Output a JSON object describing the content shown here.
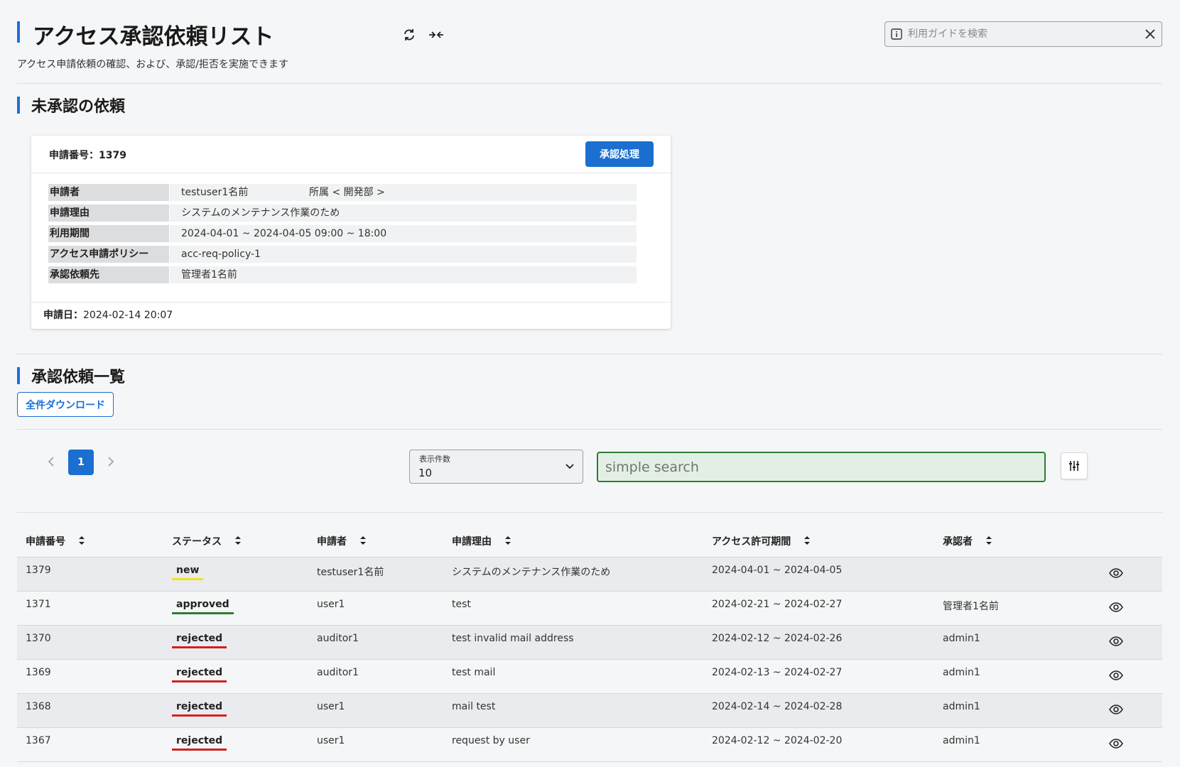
{
  "header": {
    "title": "アクセス承認依頼リスト",
    "subtitle": "アクセス申請依頼の確認、および、承認/拒否を実施できます",
    "guide_search_placeholder": "利用ガイドを検索"
  },
  "pending": {
    "section_title": "未承認の依頼",
    "card": {
      "id_label": "申請番号：1379",
      "approve_button": "承認処理",
      "details": [
        {
          "key": "申請者",
          "value": "testuser1名前",
          "extra": "所属 < 開発部 >"
        },
        {
          "key": "申請理由",
          "value": "システムのメンテナンス作業のため"
        },
        {
          "key": "利用期間",
          "value": "2024-04-01 ~ 2024-04-05 09:00 ~ 18:00"
        },
        {
          "key": "アクセス申請ポリシー",
          "value": "acc-req-policy-1"
        },
        {
          "key": "承認依頼先",
          "value": "管理者1名前"
        }
      ],
      "date_label": "申請日",
      "date_value": "2024-02-14 20:07"
    }
  },
  "list": {
    "section_title": "承認依頼一覧",
    "download_button": "全件ダウンロード",
    "pagination": {
      "current_page": "1"
    },
    "per_page": {
      "label": "表示件数",
      "value": "10"
    },
    "search_placeholder": "simple search",
    "columns": [
      "申請番号",
      "ステータス",
      "申請者",
      "申請理由",
      "アクセス許可期間",
      "承認者"
    ],
    "rows": [
      {
        "id": "1379",
        "status": "new",
        "applicant": "testuser1名前",
        "reason": "システムのメンテナンス作業のため",
        "period": "2024-04-01 ~ 2024-04-05",
        "approver": ""
      },
      {
        "id": "1371",
        "status": "approved",
        "applicant": "user1",
        "reason": "test",
        "period": "2024-02-21 ~ 2024-02-27",
        "approver": "管理者1名前"
      },
      {
        "id": "1370",
        "status": "rejected",
        "applicant": "auditor1",
        "reason": "test invalid mail address",
        "period": "2024-02-12 ~ 2024-02-26",
        "approver": "admin1"
      },
      {
        "id": "1369",
        "status": "rejected",
        "applicant": "auditor1",
        "reason": "test mail",
        "period": "2024-02-13 ~ 2024-02-27",
        "approver": "admin1"
      },
      {
        "id": "1368",
        "status": "rejected",
        "applicant": "user1",
        "reason": "mail test",
        "period": "2024-02-14 ~ 2024-02-28",
        "approver": "admin1"
      },
      {
        "id": "1367",
        "status": "rejected",
        "applicant": "user1",
        "reason": "request by user",
        "period": "2024-02-12 ~ 2024-02-20",
        "approver": "admin1"
      }
    ]
  },
  "colors": {
    "accent": "#1a6fd1",
    "status_new": "#f2e21b",
    "status_approved": "#2e7d32",
    "status_rejected": "#d32020"
  },
  "icons": [
    "refresh-icon",
    "collapse-icon",
    "info-icon",
    "close-icon",
    "chevron-left-icon",
    "chevron-right-icon",
    "chevron-down-icon",
    "filter-icon",
    "sort-icon",
    "eye-icon"
  ]
}
